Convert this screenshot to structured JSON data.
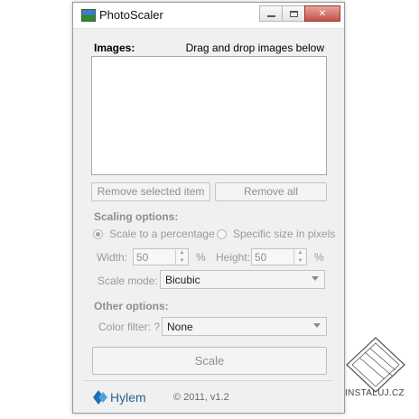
{
  "window": {
    "title": "PhotoScaler",
    "controls": {
      "minimize": "minimize",
      "maximize": "maximize",
      "close": "close"
    }
  },
  "images": {
    "label": "Images:",
    "hint": "Drag and drop images below"
  },
  "buttons": {
    "remove_selected": "Remove selected item",
    "remove_all": "Remove all",
    "scale": "Scale"
  },
  "scaling_options": {
    "heading": "Scaling options:",
    "radio_percentage": "Scale to a percentage",
    "radio_specific": "Specific size in pixels",
    "selected": "percentage",
    "width_label": "Width:",
    "width_value": "50",
    "width_unit": "%",
    "height_label": "Height:",
    "height_value": "50",
    "height_unit": "%",
    "mode_label": "Scale mode:",
    "mode_value": "Bicubic"
  },
  "other_options": {
    "heading": "Other options:",
    "filter_label": "Color filter: ?",
    "filter_value": "None"
  },
  "footer": {
    "brand": "Hylem",
    "copyright": "© 2011, v1.2"
  },
  "watermark": {
    "text": "INSTALUJ.CZ"
  }
}
